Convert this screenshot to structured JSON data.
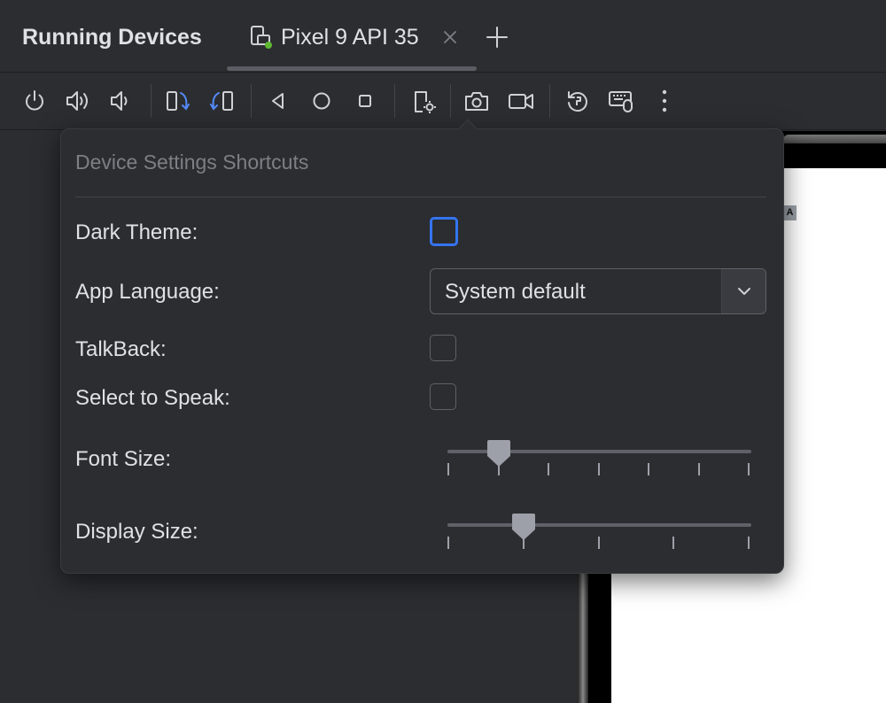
{
  "header": {
    "title": "Running Devices",
    "tab_label": "Pixel 9 API 35"
  },
  "toolbar": {
    "buttons": [
      "power",
      "volume-up",
      "volume-down",
      "rotate-left",
      "rotate-right",
      "back",
      "home",
      "overview",
      "device-settings",
      "screenshot",
      "screen-record",
      "reset",
      "keyboard",
      "more"
    ]
  },
  "device": {
    "badge": "A"
  },
  "popup": {
    "title": "Device Settings Shortcuts",
    "dark_theme_label": "Dark Theme:",
    "dark_theme_checked": false,
    "app_language_label": "App Language:",
    "app_language_value": "System default",
    "talkback_label": "TalkBack:",
    "talkback_checked": false,
    "select_to_speak_label": "Select to Speak:",
    "select_to_speak_checked": false,
    "font_size_label": "Font Size:",
    "font_size_level": 1,
    "font_size_steps": 7,
    "display_size_label": "Display Size:",
    "display_size_level": 1,
    "display_size_steps": 5
  },
  "colors": {
    "background": "#2b2d30",
    "accent": "#3574f0",
    "running_dot": "#5fb832"
  }
}
